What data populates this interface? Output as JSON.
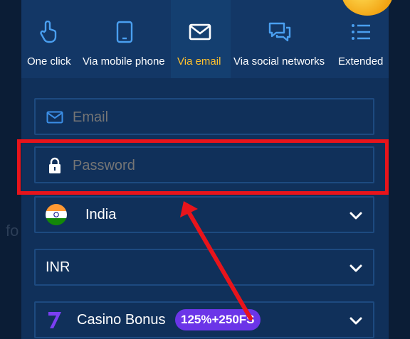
{
  "background_text": "fo",
  "tabs": [
    {
      "label": "One click",
      "icon": "pointer-hand-icon"
    },
    {
      "label": "Via mobile phone",
      "icon": "mobile-phone-icon"
    },
    {
      "label": "Via email",
      "icon": "envelope-icon",
      "active": true
    },
    {
      "label": "Via social networks",
      "icon": "chat-bubbles-icon"
    },
    {
      "label": "Extended",
      "icon": "list-icon"
    }
  ],
  "form": {
    "email_placeholder": "Email",
    "password_placeholder": "Password",
    "country": "India",
    "currency": "INR",
    "bonus_label": "Casino Bonus",
    "bonus_badge": "125%+250FS"
  },
  "colors": {
    "active_tab": "#ffc12e",
    "placeholder": "#3b8ee6",
    "highlight": "#e8141b",
    "badge": "#6b35e8"
  }
}
